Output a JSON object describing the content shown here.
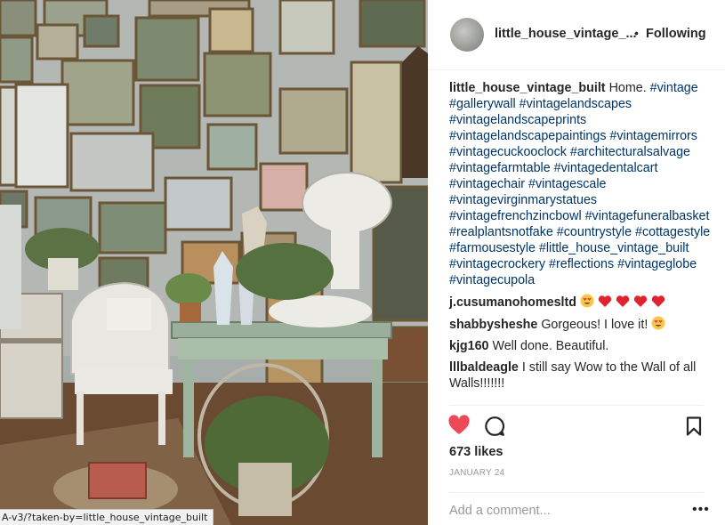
{
  "post": {
    "author": "little_house_vintage_...",
    "follow_state": "Following",
    "separator": "•",
    "avatar_icon": "avatar-image"
  },
  "caption": {
    "user": "little_house_vintage_built",
    "text": "Home.",
    "hashtags": "#vintage #gallerywall #vintagelandscapes #vintagelandscapeprints #vintagelandscapepaintings #vintagemirrors #vintagecuckooclock #architecturalsalvage #vintagefarmtable #vintagedentalcart #vintagechair #vintagescale #vintagevirginmarystatues #vintagefrenchzincbowl #vintagefuneralbasket #realplantsnotfake #countrystyle #cottagestyle #farmousestyle #little_house_vintage_built #vintagecrockery #reflections #vintageglobe #vintagecupola"
  },
  "comments": [
    {
      "user": "j.cusumanohomesltd",
      "text": "",
      "emojis": "heart-eyes, heart, heart, heart, heart"
    },
    {
      "user": "shabbysheshe",
      "text": "Gorgeous! I love it!",
      "emojis": "heart-eyes"
    },
    {
      "user": "kjg160",
      "text": "Well done. Beautiful.",
      "emojis": ""
    },
    {
      "user": "lllbaldeagle",
      "text": "I still say Wow to the Wall of all Walls!!!!!!!",
      "emojis": ""
    }
  ],
  "actions": {
    "like_icon": "heart-filled-icon",
    "comment_icon": "speech-bubble-icon",
    "save_icon": "bookmark-icon",
    "like_color": "#ed4956"
  },
  "likes": "673 likes",
  "date": "JANUARY 24",
  "add_comment": {
    "placeholder": "Add a comment...",
    "more": "•••"
  },
  "browser_status": {
    "url": "A-v3/?taken-by=little_house_vintage_built"
  }
}
